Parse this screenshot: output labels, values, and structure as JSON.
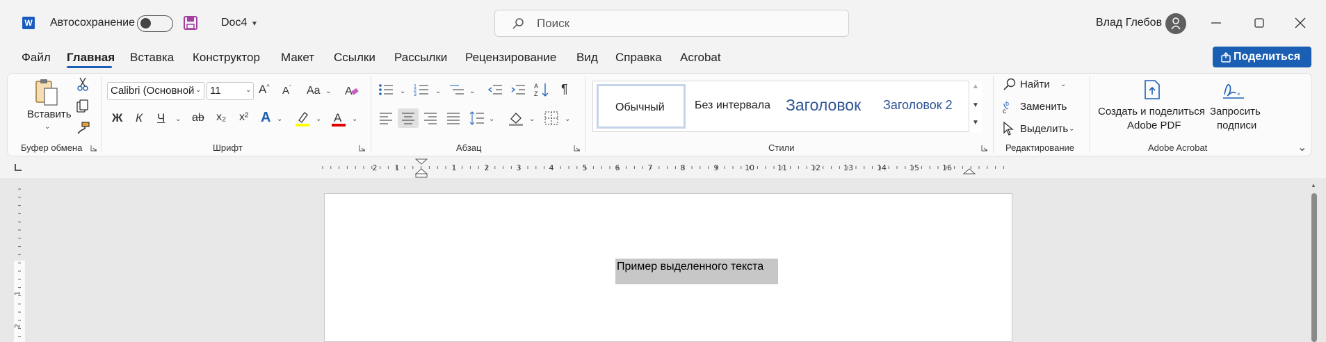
{
  "titlebar": {
    "app_icon_letter": "W",
    "autosave_label": "Автосохранение",
    "doc_name": "Doc4",
    "search_placeholder": "Поиск",
    "user_name": "Влад Глебов"
  },
  "menu": {
    "items": [
      "Файл",
      "Главная",
      "Вставка",
      "Конструктор",
      "Макет",
      "Ссылки",
      "Рассылки",
      "Рецензирование",
      "Вид",
      "Справка",
      "Acrobat"
    ],
    "active_index": 1,
    "share_label": "Поделиться"
  },
  "ribbon": {
    "clipboard": {
      "paste_label": "Вставить",
      "group_label": "Буфер обмена"
    },
    "font": {
      "font_name": "Calibri (Основной",
      "font_size": "11",
      "case_label": "Aa",
      "bold": "Ж",
      "italic": "К",
      "underline": "Ч",
      "strike": "ab",
      "sub": "x₂",
      "sup": "x²",
      "group_label": "Шрифт"
    },
    "paragraph": {
      "group_label": "Абзац"
    },
    "styles": {
      "items": [
        "Обычный",
        "Без интервала",
        "Заголовок",
        "Заголовок 2"
      ],
      "group_label": "Стили"
    },
    "editing": {
      "find": "Найти",
      "replace": "Заменить",
      "select": "Выделить",
      "group_label": "Редактирование"
    },
    "acrobat": {
      "create_line1": "Создать и поделиться",
      "create_line2": "Adobe PDF",
      "request_line1": "Запросить",
      "request_line2": "подписи",
      "group_label": "Adobe Acrobat"
    }
  },
  "ruler": {
    "numbers": [
      "2",
      "1",
      "1",
      "2",
      "3",
      "4",
      "5",
      "6",
      "7",
      "8",
      "9",
      "10",
      "11",
      "12",
      "13",
      "14",
      "15",
      "16"
    ],
    "vertical_numbers": [
      "1",
      "2"
    ]
  },
  "document": {
    "selected_text": "Пример выделенного текста"
  },
  "colors": {
    "accent": "#1a5fb4",
    "highlight": "#ffff00",
    "font_color": "#e00000",
    "save_icon": "#a23fa0"
  }
}
